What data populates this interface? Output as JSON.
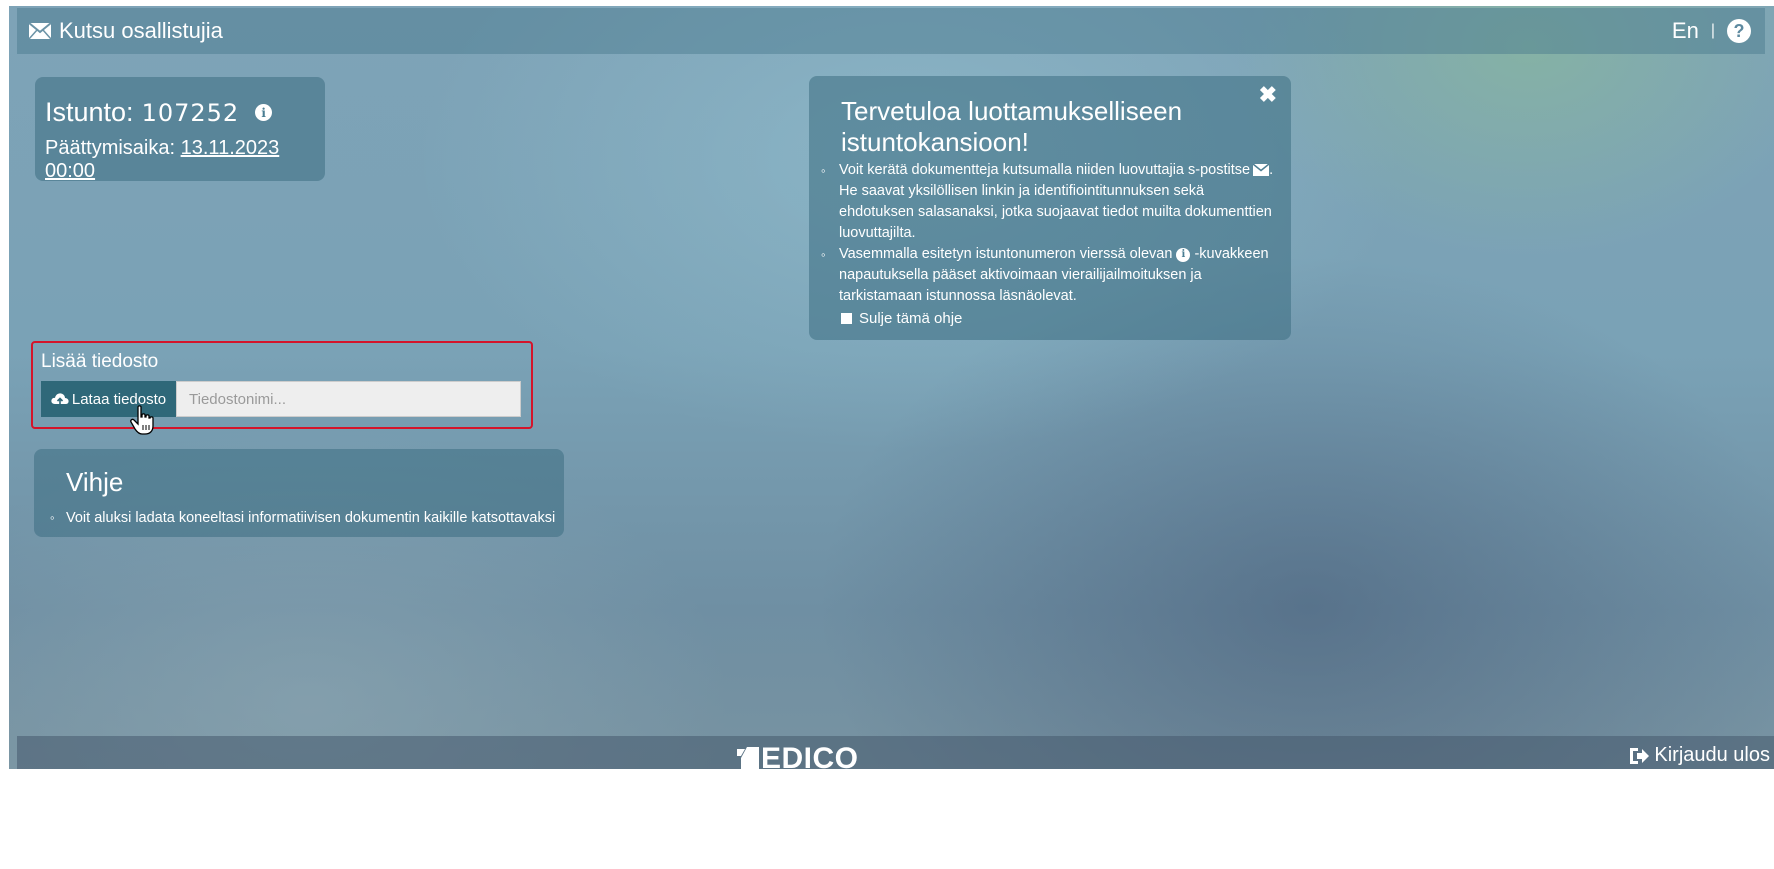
{
  "topbar": {
    "title": "Kutsu osallistujia",
    "language": "En",
    "separator": "|",
    "help_icon": "question-circle-icon"
  },
  "session": {
    "label": "Istunto:",
    "number": "107252",
    "end_label": "Päättymisaika:",
    "end_date": "13.11.2023 00:00"
  },
  "welcome": {
    "title": "Tervetuloa luottamukselliseen istuntokansioon!",
    "item1_a": "Voit kerätä dokumentteja kutsumalla niiden luovuttajia s-postitse",
    "item1_b": ". He saavat yksilöllisen linkin ja identifiointitunnuksen sekä ehdotuksen salasanaksi, jotka suojaavat tiedot muilta dokumenttien luovuttajilta.",
    "item2_a": "Vasemmalla esitetyn istuntonumeron vierssä olevan",
    "item2_b": "-kuvakkeen napautuksella pääset aktivoimaan vierailijailmoituksen ja tarkistamaan istunnossa läsnäolevat.",
    "checkbox_label": "Sulje tämä ohje",
    "close_symbol": "✖"
  },
  "upload": {
    "label": "Lisää tiedosto",
    "button_label": "Lataa tiedosto",
    "placeholder": "Tiedostonimi..."
  },
  "hint": {
    "title": "Vihje",
    "text": "Voit aluksi ladata koneeltasi informatiivisen dokumentin kaikille katsottavaksi"
  },
  "footer": {
    "logo": "EDICO",
    "logout": "Kirjaudu ulos"
  }
}
